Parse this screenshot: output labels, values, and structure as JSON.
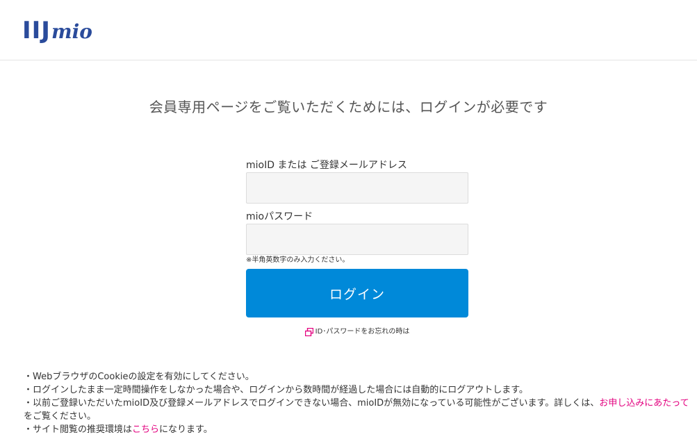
{
  "header": {
    "logo_main": "IIJ",
    "logo_sub": "mio",
    "brand_color": "#2a4b9b"
  },
  "headline": "会員専用ページをご覧いただくためには、ログインが必要です",
  "form": {
    "id_label": "mioID または ご登録メールアドレス",
    "id_value": "",
    "password_label": "mioパスワード",
    "password_value": "",
    "hint": "※半角英数字のみ入力ください。",
    "login_button": "ログイン",
    "login_button_color": "#0089d9",
    "forgot_link": "ID･パスワードをお忘れの時は",
    "forgot_icon": "new-window-icon"
  },
  "notes": [
    {
      "bullet": "・",
      "text": "WebブラウザのCookieの設定を有効にしてください。"
    },
    {
      "bullet": "・",
      "text": "ログインしたまま一定時間操作をしなかった場合や、ログインから数時間が経過した場合には自動的にログアウトします。"
    },
    {
      "bullet": "・",
      "text_before": "以前ご登録いただいたmioID及び登録メールアドレスでログインできない場合、mioIDが無効になっている可能性がございます。詳しくは、",
      "link": "お申し込みにあたって",
      "text_after": "をご覧ください。"
    },
    {
      "bullet": "・",
      "text_before": "サイト閲覧の推奨環境は",
      "link": "こちら",
      "text_after": "になります。"
    }
  ],
  "link_color": "#e3007f"
}
